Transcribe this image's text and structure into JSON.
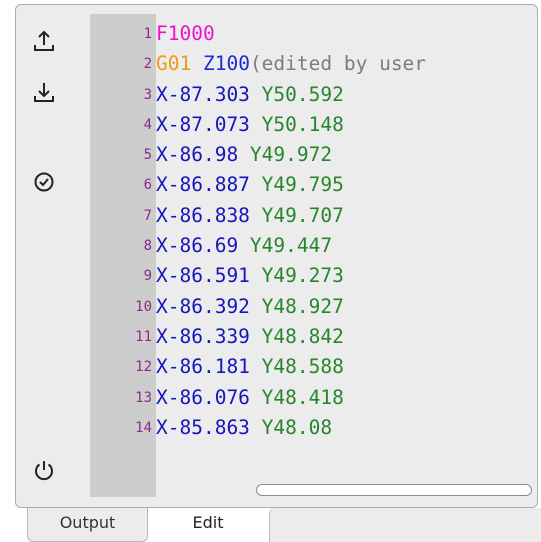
{
  "toolbar": {
    "upload": {
      "icon": "upload-icon"
    },
    "download": {
      "icon": "download-icon"
    },
    "check": {
      "icon": "check-circle-icon"
    },
    "power": {
      "icon": "power-icon"
    }
  },
  "editor": {
    "lines": [
      {
        "num": "1",
        "tokens": [
          {
            "text": "F1000",
            "kind": "f"
          }
        ]
      },
      {
        "num": "2",
        "tokens": [
          {
            "text": "G01 ",
            "kind": "g"
          },
          {
            "text": "Z100",
            "kind": "z"
          },
          {
            "text": "(edited by user",
            "kind": "c"
          }
        ]
      },
      {
        "num": "3",
        "tokens": [
          {
            "text": "X-87.303 ",
            "kind": "x"
          },
          {
            "text": "Y50.592",
            "kind": "y"
          }
        ]
      },
      {
        "num": "4",
        "tokens": [
          {
            "text": "X-87.073 ",
            "kind": "x"
          },
          {
            "text": "Y50.148",
            "kind": "y"
          }
        ]
      },
      {
        "num": "5",
        "tokens": [
          {
            "text": "X-86.98 ",
            "kind": "x"
          },
          {
            "text": "Y49.972",
            "kind": "y"
          }
        ]
      },
      {
        "num": "6",
        "tokens": [
          {
            "text": "X-86.887 ",
            "kind": "x"
          },
          {
            "text": "Y49.795",
            "kind": "y"
          }
        ]
      },
      {
        "num": "7",
        "tokens": [
          {
            "text": "X-86.838 ",
            "kind": "x"
          },
          {
            "text": "Y49.707",
            "kind": "y"
          }
        ]
      },
      {
        "num": "8",
        "tokens": [
          {
            "text": "X-86.69 ",
            "kind": "x"
          },
          {
            "text": "Y49.447",
            "kind": "y"
          }
        ]
      },
      {
        "num": "9",
        "tokens": [
          {
            "text": "X-86.591 ",
            "kind": "x"
          },
          {
            "text": "Y49.273",
            "kind": "y"
          }
        ]
      },
      {
        "num": "10",
        "tokens": [
          {
            "text": "X-86.392 ",
            "kind": "x"
          },
          {
            "text": "Y48.927",
            "kind": "y"
          }
        ]
      },
      {
        "num": "11",
        "tokens": [
          {
            "text": "X-86.339 ",
            "kind": "x"
          },
          {
            "text": "Y48.842",
            "kind": "y"
          }
        ]
      },
      {
        "num": "12",
        "tokens": [
          {
            "text": "X-86.181 ",
            "kind": "x"
          },
          {
            "text": "Y48.588",
            "kind": "y"
          }
        ]
      },
      {
        "num": "13",
        "tokens": [
          {
            "text": "X-86.076 ",
            "kind": "x"
          },
          {
            "text": "Y48.418",
            "kind": "y"
          }
        ]
      },
      {
        "num": "14",
        "tokens": [
          {
            "text": "X-85.863 ",
            "kind": "x"
          },
          {
            "text": "Y48.08",
            "kind": "y"
          }
        ]
      }
    ]
  },
  "tabs": [
    {
      "label": "Output",
      "active": false
    },
    {
      "label": "Edit",
      "active": true
    }
  ],
  "colors": {
    "feed": "#ef12cd",
    "gcode": "#ee9a17",
    "z_axis": "#1d2bdb",
    "comment": "#7c7c7c",
    "x_axis": "#1515bd",
    "y_axis": "#27862d",
    "line_number": "#8a2b8a"
  }
}
